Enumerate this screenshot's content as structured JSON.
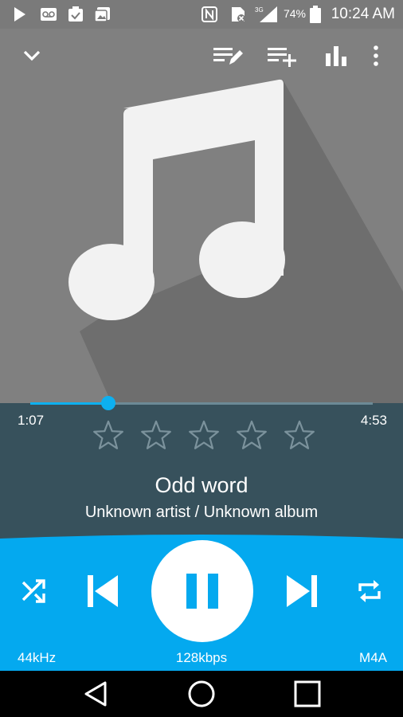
{
  "status_bar": {
    "battery_percent": "74%",
    "time": "10:24 AM",
    "icons": [
      "play-store-icon",
      "voicemail-icon",
      "task-icon",
      "photos-icon",
      "nfc-icon",
      "no-sim-icon",
      "signal-icon",
      "battery-icon"
    ]
  },
  "toolbar": {
    "icons": [
      "chevron-down-icon",
      "edit-queue-icon",
      "add-to-playlist-icon",
      "equalizer-icon",
      "more-vert-icon"
    ]
  },
  "playback": {
    "position": "1:07",
    "duration": "4:53",
    "progress_fraction": 0.228
  },
  "rating": {
    "max": 5,
    "value": 0
  },
  "track": {
    "title": "Odd word",
    "subtitle": "Unknown artist / Unknown album"
  },
  "controls": {
    "icons": [
      "shuffle-icon",
      "previous-icon",
      "pause-icon",
      "next-icon",
      "repeat-icon"
    ]
  },
  "format": {
    "sample_rate": "44kHz",
    "bitrate": "128kbps",
    "codec": "M4A"
  },
  "colors": {
    "accent": "#04a9ef",
    "info_panel": "#37515c",
    "artwork_bg": "#808080"
  }
}
